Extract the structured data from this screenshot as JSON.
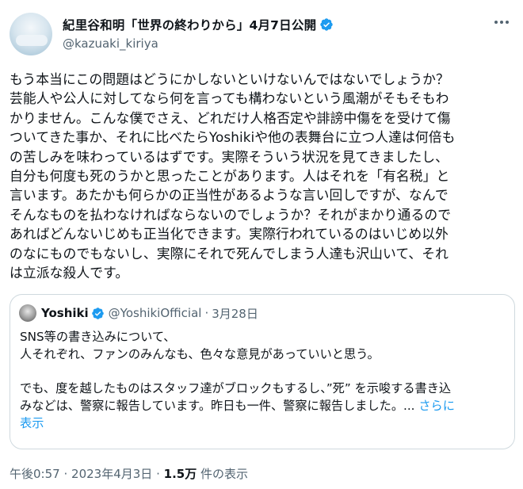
{
  "tweet": {
    "author_name": "紀里谷和明「世界の終わりから」4月7日公開",
    "author_handle": "@kazuaki_kiriya",
    "body": "もう本当にこの問題はどうにかしないといけないんではないでしょうか？\n芸能人や公人に対してなら何を言っても構わないという風潮がそもそもわ\nかりません。こんな僕でさえ、どれだけ人格否定や誹謗中傷をを受けて傷\nついてきた事か、それに比べたらYoshikiや他の表舞台に立つ人達は何倍も\nの苦しみを味わっているはずです。実際そういう状況を見てきましたし、\n自分も何度も死のうかと思ったことがあります。人はそれを「有名税」と\n言います。あたかも何らかの正当性があるような言い回しですが、なんで\nそんなものを払わなければならないのでしょうか？それがまかり通るので\nあればどんないじめも正当化できます。実際行われているのはいじめ以外\nのなにものでもないし、実際にそれで死んでしまう人達も沢山いて、それ\nは立派な殺人です。",
    "time": "午後0:57",
    "date": "2023年4月3日",
    "views_count": "1.5万",
    "views_label": "件の表示",
    "dot": "·"
  },
  "quote": {
    "author_name": "Yoshiki",
    "author_handle": "@YoshikiOfficial",
    "dot": "·",
    "date": "3月28日",
    "text": "SNS等の書き込みについて、\n人それぞれ、ファンのみんなも、色々な意見があっていいと思う。\n\nでも、度を越したものはスタッフ達がブロックもするし、”死” を示唆する書き込\nみなどは、警察に報告しています。昨日も一件、警察に報告しました。... ",
    "more_label": "さらに\n表示"
  },
  "icons": {
    "verified": "verified-badge-icon",
    "more": "more-options-icon"
  },
  "colors": {
    "accent": "#1d9bf0",
    "text_primary": "#0f1419",
    "text_secondary": "#536471",
    "border": "#cfd9de"
  }
}
